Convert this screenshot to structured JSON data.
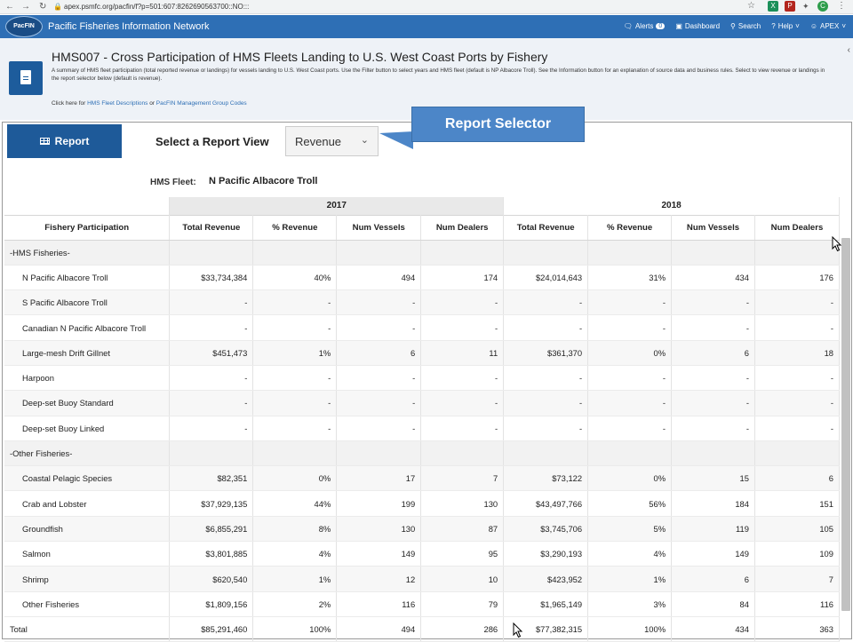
{
  "browser": {
    "url": "apex.psmfc.org/pacfin/f?p=501:607:8262690563700::NO:::",
    "profile_initial": "C"
  },
  "app": {
    "logo_text": "PacFIN",
    "title": "Pacific Fisheries Information Network",
    "nav": {
      "alerts_label": "Alerts",
      "alerts_count": "0",
      "dashboard_label": "Dashboard",
      "search_label": "Search",
      "help_label": "Help",
      "user_label": "APEX"
    }
  },
  "header": {
    "title": "HMS007 - Cross Participation of HMS Fleets Landing to U.S. West Coast Ports by Fishery",
    "description": "A summary of HMS fleet participation (total reported revenue or landings) for vessels landing to U.S. West Coast ports. Use the Filter button to select years and HMS fleet (default is NP Albacore Troll). See the Information button for an explanation of source data and business rules. Select to view revenue or landings in the report selector below (default is revenue).",
    "links_prefix": "Click here for",
    "link_fleet": "HMS Fleet Descriptions",
    "links_or": "or",
    "link_groups": "PacFIN Management Group Codes"
  },
  "report": {
    "report_button_label": "Report",
    "selector_label": "Select a Report View",
    "selector_value": "Revenue",
    "callout_label": "Report Selector",
    "fleet_label": "HMS Fleet:",
    "fleet_value": "N Pacific Albacore Troll"
  },
  "table": {
    "years": [
      "2017",
      "2018"
    ],
    "columns": [
      "Fishery Participation",
      "Total Revenue",
      "% Revenue",
      "Num Vessels",
      "Num Dealers",
      "Total Revenue",
      "% Revenue",
      "Num Vessels",
      "Num Dealers"
    ],
    "rows": [
      {
        "type": "group",
        "cells": [
          "-HMS Fisheries-",
          "",
          "",
          "",
          "",
          "",
          "",
          "",
          ""
        ]
      },
      {
        "type": "row",
        "cells": [
          "N Pacific Albacore Troll",
          "$33,734,384",
          "40%",
          "494",
          "174",
          "$24,014,643",
          "31%",
          "434",
          "176"
        ]
      },
      {
        "type": "row",
        "cells": [
          "S Pacific Albacore Troll",
          "-",
          "-",
          "-",
          "-",
          "-",
          "-",
          "-",
          "-"
        ]
      },
      {
        "type": "row",
        "cells": [
          "Canadian N Pacific Albacore Troll",
          "-",
          "-",
          "-",
          "-",
          "-",
          "-",
          "-",
          "-"
        ]
      },
      {
        "type": "row",
        "cells": [
          "Large-mesh Drift Gillnet",
          "$451,473",
          "1%",
          "6",
          "11",
          "$361,370",
          "0%",
          "6",
          "18"
        ]
      },
      {
        "type": "row",
        "cells": [
          "Harpoon",
          "-",
          "-",
          "-",
          "-",
          "-",
          "-",
          "-",
          "-"
        ]
      },
      {
        "type": "row",
        "cells": [
          "Deep-set Buoy Standard",
          "-",
          "-",
          "-",
          "-",
          "-",
          "-",
          "-",
          "-"
        ]
      },
      {
        "type": "row",
        "cells": [
          "Deep-set Buoy Linked",
          "-",
          "-",
          "-",
          "-",
          "-",
          "-",
          "-",
          "-"
        ]
      },
      {
        "type": "group",
        "cells": [
          "-Other Fisheries-",
          "",
          "",
          "",
          "",
          "",
          "",
          "",
          ""
        ]
      },
      {
        "type": "row",
        "cells": [
          "Coastal Pelagic Species",
          "$82,351",
          "0%",
          "17",
          "7",
          "$73,122",
          "0%",
          "15",
          "6"
        ]
      },
      {
        "type": "row",
        "cells": [
          "Crab and Lobster",
          "$37,929,135",
          "44%",
          "199",
          "130",
          "$43,497,766",
          "56%",
          "184",
          "151"
        ]
      },
      {
        "type": "row",
        "cells": [
          "Groundfish",
          "$6,855,291",
          "8%",
          "130",
          "87",
          "$3,745,706",
          "5%",
          "119",
          "105"
        ]
      },
      {
        "type": "row",
        "cells": [
          "Salmon",
          "$3,801,885",
          "4%",
          "149",
          "95",
          "$3,290,193",
          "4%",
          "149",
          "109"
        ]
      },
      {
        "type": "row",
        "cells": [
          "Shrimp",
          "$620,540",
          "1%",
          "12",
          "10",
          "$423,952",
          "1%",
          "6",
          "7"
        ]
      },
      {
        "type": "row",
        "cells": [
          "Other Fisheries",
          "$1,809,156",
          "2%",
          "116",
          "79",
          "$1,965,149",
          "3%",
          "84",
          "116"
        ]
      },
      {
        "type": "total",
        "cells": [
          "Total",
          "$85,291,460",
          "100%",
          "494",
          "286",
          "$77,382,315",
          "100%",
          "434",
          "363"
        ]
      }
    ]
  },
  "colors": {
    "navbar": "#2e6fb5",
    "report_button": "#1e5a99",
    "callout": "#4c86c8",
    "header_bg": "#eef2f7"
  }
}
